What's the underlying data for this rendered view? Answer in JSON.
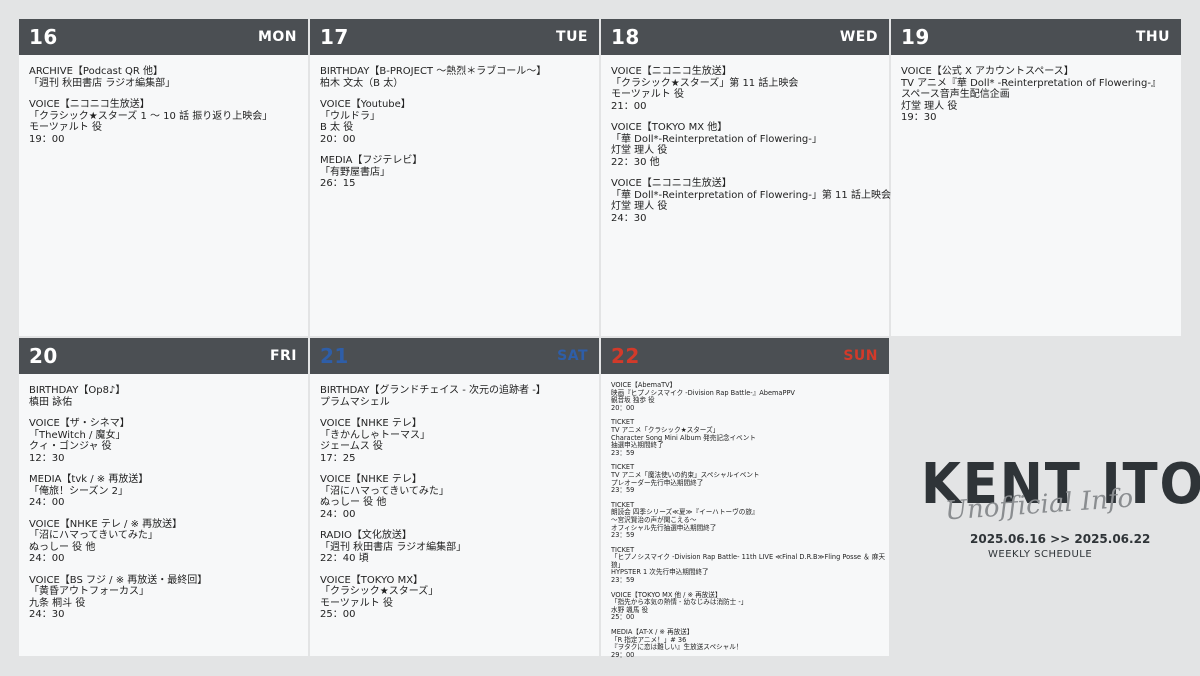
{
  "days": [
    {
      "num": "16",
      "name": "MON",
      "entries": [
        [
          "ARCHIVE【Podcast QR 他】",
          "「週刊 秋田書店 ラジオ編集部」"
        ],
        [
          "VOICE【ニコニコ生放送】",
          "「クラシック★スターズ 1 〜 10 話 振り返り上映会」",
          "モーツァルト 役",
          "19：00"
        ]
      ]
    },
    {
      "num": "17",
      "name": "TUE",
      "entries": [
        [
          "BIRTHDAY【B-PROJECT 〜熱烈＊ラブコール〜】",
          "柏木 文太（B 太）"
        ],
        [
          "VOICE【Youtube】",
          "「ウルドラ」",
          "B 太 役",
          "20：00"
        ],
        [
          "MEDIA【フジテレビ】",
          "「有野屋書店」",
          "26：15"
        ]
      ]
    },
    {
      "num": "18",
      "name": "WED",
      "entries": [
        [
          "VOICE【ニコニコ生放送】",
          "「クラシック★スターズ」第 11 話上映会",
          "モーツァルト 役",
          "21：00"
        ],
        [
          "VOICE【TOKYO MX 他】",
          "「華 Doll*-Reinterpretation of Flowering-」",
          "灯堂 理人 役",
          "22：30 他"
        ],
        [
          "VOICE【ニコニコ生放送】",
          "「華 Doll*-Reinterpretation of Flowering-」第 11 話上映会",
          "灯堂 理人 役",
          "24：30"
        ]
      ]
    },
    {
      "num": "19",
      "name": "THU",
      "entries": [
        [
          "VOICE【公式 X アカウントスペース】",
          "TV アニメ『華 Doll* -Reinterpretation of Flowering-』",
          "スペース音声生配信企画",
          "灯堂 理人 役",
          "19：30"
        ]
      ]
    },
    {
      "num": "20",
      "name": "FRI",
      "entries": [
        [
          "BIRTHDAY【Op8♪】",
          "槙田 詠佑"
        ],
        [
          "VOICE【ザ・シネマ】",
          "「TheWitch / 魔女」",
          "クィ・ゴンジャ 役",
          "12：30"
        ],
        [
          "MEDIA【tvk / ※ 再放送】",
          "「俺旅！シーズン 2」",
          "24：00"
        ],
        [
          "VOICE【NHKE テレ / ※ 再放送】",
          "「沼にハマってきいてみた」",
          "ぬっしー 役 他",
          "24：00"
        ],
        [
          "VOICE【BS フジ / ※ 再放送・最終回】",
          "「黄昏アウトフォーカス」",
          "九条 桐斗 役",
          "24：30"
        ]
      ]
    },
    {
      "num": "21",
      "name": "SAT",
      "entries": [
        [
          "BIRTHDAY【グランドチェイス - 次元の追跡者 -】",
          "プラムマシェル"
        ],
        [
          "VOICE【NHKE テレ】",
          "「きかんしゃトーマス」",
          "ジェームス 役",
          "17：25"
        ],
        [
          "VOICE【NHKE テレ】",
          "「沼にハマってきいてみた」",
          "ぬっしー 役 他",
          "24：00"
        ],
        [
          "RADIO【文化放送】",
          "「週刊 秋田書店 ラジオ編集部」",
          "22：40 頃"
        ],
        [
          "VOICE【TOKYO MX】",
          "「クラシック★スターズ」",
          "モーツァルト 役",
          "25：00"
        ]
      ]
    },
    {
      "num": "22",
      "name": "SUN",
      "entries": [
        [
          "VOICE【AbemaTV】",
          "映画『ヒプノシスマイク -Division Rap Battle-』AbemaPPV",
          "観音坂 独歩 役",
          "20：00"
        ],
        [
          "TICKET",
          "TV アニメ「クラシック★スターズ」",
          "Character Song Mini Album 発売記念イベント",
          "抽選申込期間終了",
          "23：59"
        ],
        [
          "TICKET",
          "TV アニメ「魔法使いの約束」スペシャルイベント",
          "プレオーダー先行申込期間終了",
          "23：59"
        ],
        [
          "TICKET",
          "朗読会 四季シリーズ≪夏≫『イーハトーヴの旅』",
          "〜宮沢賢治の声が聞こえる〜",
          "オフィシャル先行抽選申込期間終了",
          "23：59"
        ],
        [
          "TICKET",
          "「ヒプノシスマイク -Division Rap Battle- 11th LIVE ≪Final D.R.B≫Fling Posse ＆ 麻天",
          "狼」",
          "HYPSTER 1 次先行申込期間終了",
          "23：59"
        ],
        [
          "VOICE【TOKYO MX 他 / ※ 再放送】",
          "「指先から本気の熱情 - 幼なじみは消防士 -」",
          "水野 颯馬 役",
          "25：00"
        ],
        [
          "MEDIA【AT-X / ※ 再放送】",
          "「R 指定アニメ！」# 36",
          "『ヲタクに恋は難しい』生放送スペシャル！",
          "29：00"
        ]
      ]
    }
  ],
  "branding": {
    "title": "KENT ITO",
    "script": "Unofficial Info",
    "dates": "2025.06.16 >> 2025.06.22",
    "subtitle": "WEEKLY SCHEDULE"
  }
}
